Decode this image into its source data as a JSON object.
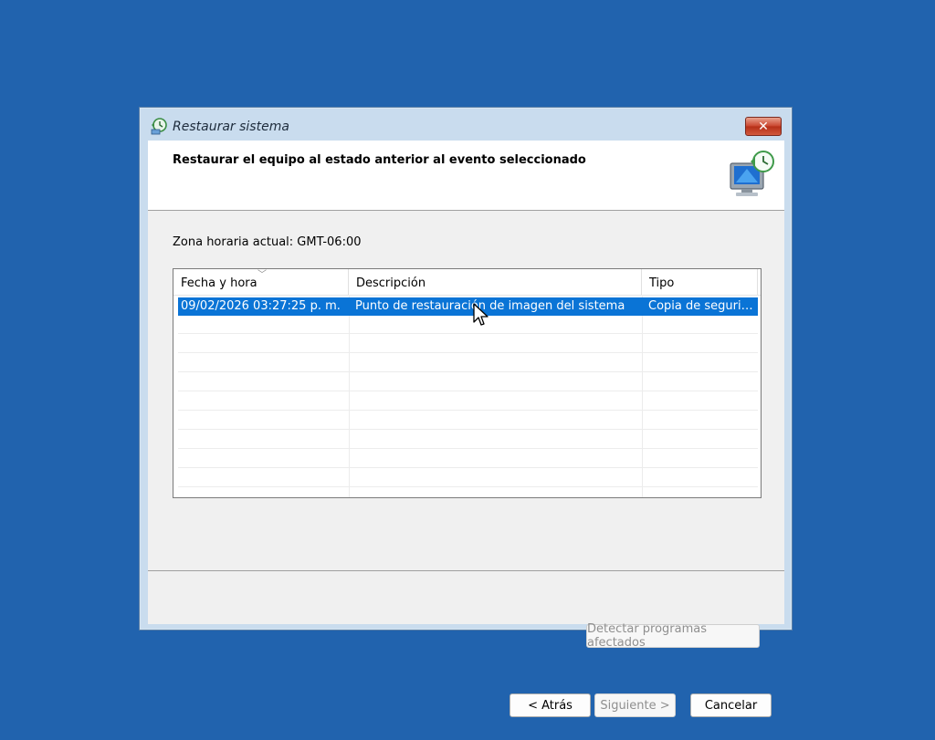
{
  "window": {
    "title": "Restaurar sistema",
    "close_label": "✕"
  },
  "header": {
    "title": "Restaurar el equipo al estado anterior al evento seleccionado"
  },
  "timezone_label": "Zona horaria actual: GMT-06:00",
  "table": {
    "columns": [
      "Fecha y hora",
      "Descripción",
      "Tipo"
    ],
    "rows": [
      {
        "date": "09/02/2026 03:27:25 p. m.",
        "description": "Punto de restauración de imagen del sistema",
        "type": "Copia de seguri…"
      }
    ]
  },
  "buttons": {
    "detect": "Detectar programas afectados",
    "back": "< Atrás",
    "next": "Siguiente >",
    "cancel": "Cancelar"
  },
  "colors": {
    "desktop": "#2163ae",
    "selection": "#0a74d6"
  },
  "icons": {
    "title": "system-restore-icon",
    "header": "restore-computer-icon",
    "sort": "sort-desc-icon",
    "cursor": "mouse-pointer-icon"
  }
}
